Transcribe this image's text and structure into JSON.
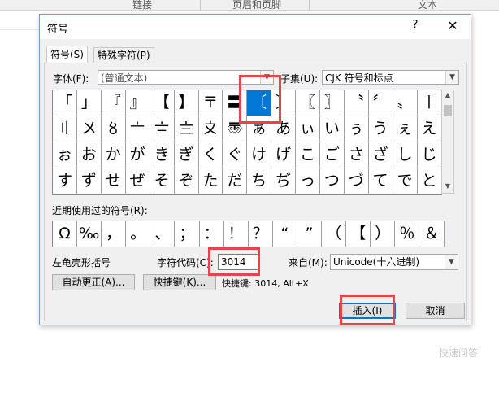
{
  "background": {
    "ribbon_items": [
      "链接",
      "页眉和页脚",
      "文本"
    ],
    "watermark": "快速问答"
  },
  "dialog": {
    "title": "符号",
    "help": "?",
    "close": "✕",
    "tabs": [
      "符号(S)",
      "特殊字符(P)"
    ],
    "font_label": "字体(F):",
    "font_value": "(普通文本)",
    "subset_label": "子集(U):",
    "subset_value": "CJK 符号和标点",
    "grid_rows": [
      [
        "「",
        "」",
        "『",
        "』",
        "【",
        "】",
        "〒",
        "〓",
        "〔",
        "〕",
        "〖",
        "〗",
        "〝",
        "〞",
        "〟",
        "〡"
      ],
      [
        "〢",
        "〤",
        "〥",
        "〦",
        "〧",
        "〨",
        "〩",
        "〠",
        "ぁ",
        "あ",
        "ぃ",
        "い",
        "ぅ",
        "う",
        "ぇ",
        "え"
      ],
      [
        "ぉ",
        "お",
        "か",
        "が",
        "き",
        "ぎ",
        "く",
        "ぐ",
        "け",
        "げ",
        "こ",
        "ご",
        "さ",
        "ざ",
        "し",
        "じ"
      ],
      [
        "す",
        "ず",
        "せ",
        "ぜ",
        "そ",
        "ぞ",
        "た",
        "だ",
        "ち",
        "ぢ",
        "っ",
        "つ",
        "づ",
        "て",
        "で",
        "と"
      ]
    ],
    "selected_cell": "0-8",
    "recent_label": "近期使用过的符号(R):",
    "recent_symbols": [
      "Ω",
      "‰",
      "，",
      "。",
      "、",
      "；",
      "：",
      "！",
      "？",
      "“",
      "”",
      "（",
      "【",
      "）",
      "％",
      "＆"
    ],
    "char_name": "左龟壳形括号",
    "char_code_label": "字符代码(C):",
    "char_code_value": "3014",
    "from_label": "来自(M):",
    "from_value": "Unicode(十六进制)",
    "autocorrect_button": "自动更正(A)...",
    "shortcut_button": "快捷键(K)...",
    "shortcut_text": "快捷键: 3014, Alt+X",
    "insert_button": "插入(I)",
    "cancel_button": "取消"
  },
  "colors": {
    "highlight": "#e8424b",
    "selection": "#0078d7"
  }
}
